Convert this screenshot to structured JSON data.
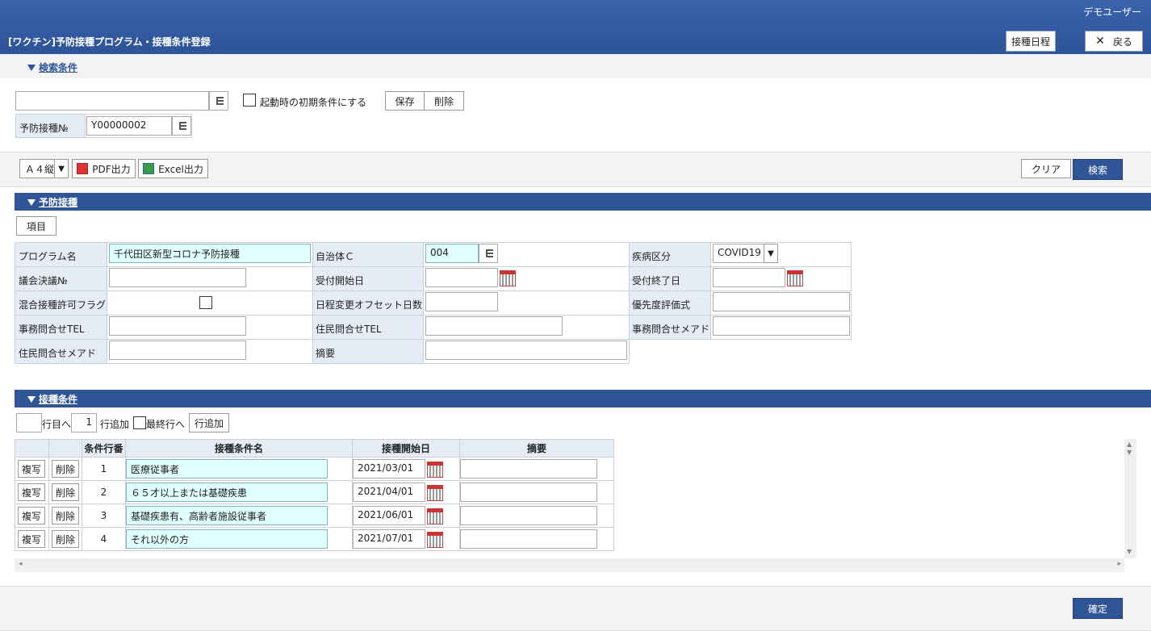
{
  "header": {
    "user": "デモユーザー",
    "title": "[ワクチン]予防接種プログラム・接種条件登録",
    "schedule_btn": "接種日程",
    "back_btn": "戻る"
  },
  "search": {
    "section_title": "検索条件",
    "condition_value": "",
    "initial_cond_label": "起動時の初期条件にする",
    "save_btn": "保存",
    "delete_btn": "削除",
    "no_label": "予防接種№",
    "no_value": "Y00000002"
  },
  "toolbar": {
    "paper": "Ａ４縦",
    "pdf_btn": "PDF出力",
    "excel_btn": "Excel出力",
    "clear_btn": "クリア",
    "search_btn": "検索"
  },
  "vaccination": {
    "section_title": "予防接種",
    "item_btn": "項目",
    "program_label": "プログラム名",
    "program_value": "千代田区新型コロナ予防接種",
    "muni_label": "自治体Ｃ",
    "muni_value": "004",
    "disease_label": "疾病区分",
    "disease_value": "COVID19",
    "resolution_label": "議会決議№",
    "recv_start_label": "受付開始日",
    "recv_end_label": "受付終了日",
    "mixed_label": "混合接種許可フラグ",
    "offset_label": "日程変更オフセット日数",
    "priority_label": "優先度評価式",
    "office_tel_label": "事務問合せTEL",
    "resident_tel_label": "住民問合せTEL",
    "office_mail_label": "事務問合せメアド",
    "resident_mail_label": "住民問合せメアド",
    "summary_label": "摘要"
  },
  "conditions": {
    "section_title": "接種条件",
    "row_goto_suffix": "行目へ",
    "add_count": "1",
    "add_suffix": "行追加",
    "last_row_label": "最終行へ",
    "add_row_btn": "行追加",
    "columns": [
      "条件行番",
      "接種条件名",
      "接種開始日",
      "摘要"
    ],
    "copy_btn": "複写",
    "del_btn": "削除",
    "rows": [
      {
        "no": "1",
        "name": "医療従事者",
        "date": "2021/03/01"
      },
      {
        "no": "2",
        "name": "６５才以上または基礎疾患",
        "date": "2021/04/01"
      },
      {
        "no": "3",
        "name": "基礎疾患有、高齢者施設従事者",
        "date": "2021/06/01"
      },
      {
        "no": "4",
        "name": "それ以外の方",
        "date": "2021/07/01"
      }
    ]
  },
  "footer": {
    "confirm_btn": "確定"
  }
}
